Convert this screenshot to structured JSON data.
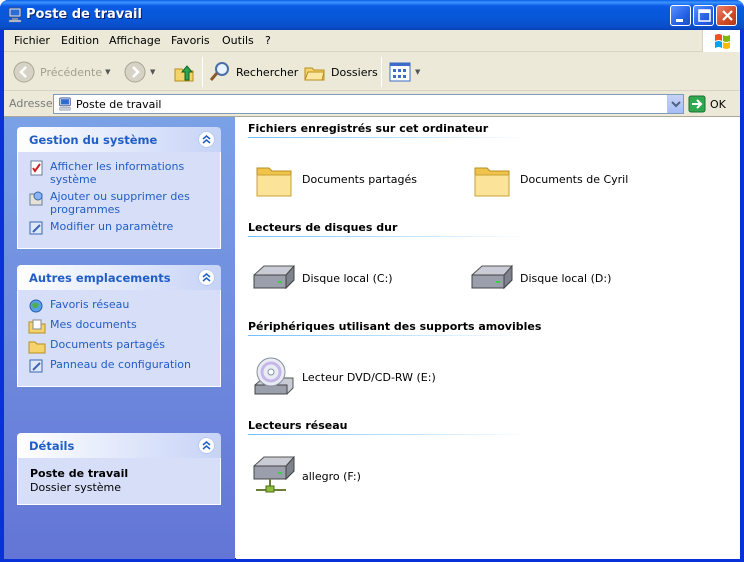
{
  "window": {
    "title": "Poste de travail"
  },
  "menu": {
    "items": [
      "Fichier",
      "Edition",
      "Affichage",
      "Favoris",
      "Outils",
      "?"
    ]
  },
  "toolbar": {
    "back_label": "Précédente",
    "search_label": "Rechercher",
    "folders_label": "Dossiers"
  },
  "address": {
    "label": "Adresse",
    "value": "Poste de travail",
    "go_label": "OK"
  },
  "taskpane": {
    "system": {
      "title": "Gestion du système",
      "items": [
        "Afficher les informations système",
        "Ajouter ou supprimer des programmes",
        "Modifier un paramètre"
      ]
    },
    "places": {
      "title": "Autres emplacements",
      "items": [
        "Favoris réseau",
        "Mes documents",
        "Documents partagés",
        "Panneau de configuration"
      ]
    },
    "details": {
      "title": "Détails",
      "name": "Poste de travail",
      "type": "Dossier système"
    }
  },
  "main": {
    "sections": [
      {
        "title": "Fichiers enregistrés sur cet ordinateur",
        "items": [
          "Documents partagés",
          "Documents de Cyril"
        ]
      },
      {
        "title": "Lecteurs de disques dur",
        "items": [
          "Disque local (C:)",
          "Disque local (D:)"
        ]
      },
      {
        "title": "Périphériques utilisant des supports amovibles",
        "items": [
          "Lecteur DVD/CD-RW (E:)"
        ]
      },
      {
        "title": "Lecteurs réseau",
        "items": [
          "allegro (F:)"
        ]
      }
    ]
  },
  "icons": {
    "folder": "folder-icon",
    "drive": "hard-drive-icon",
    "dvd": "dvd-drive-icon",
    "network_drive": "network-drive-icon"
  },
  "colors": {
    "title_bar": "#0a5ae4",
    "task_pane": "#7aa1e6",
    "link": "#215dc6"
  }
}
